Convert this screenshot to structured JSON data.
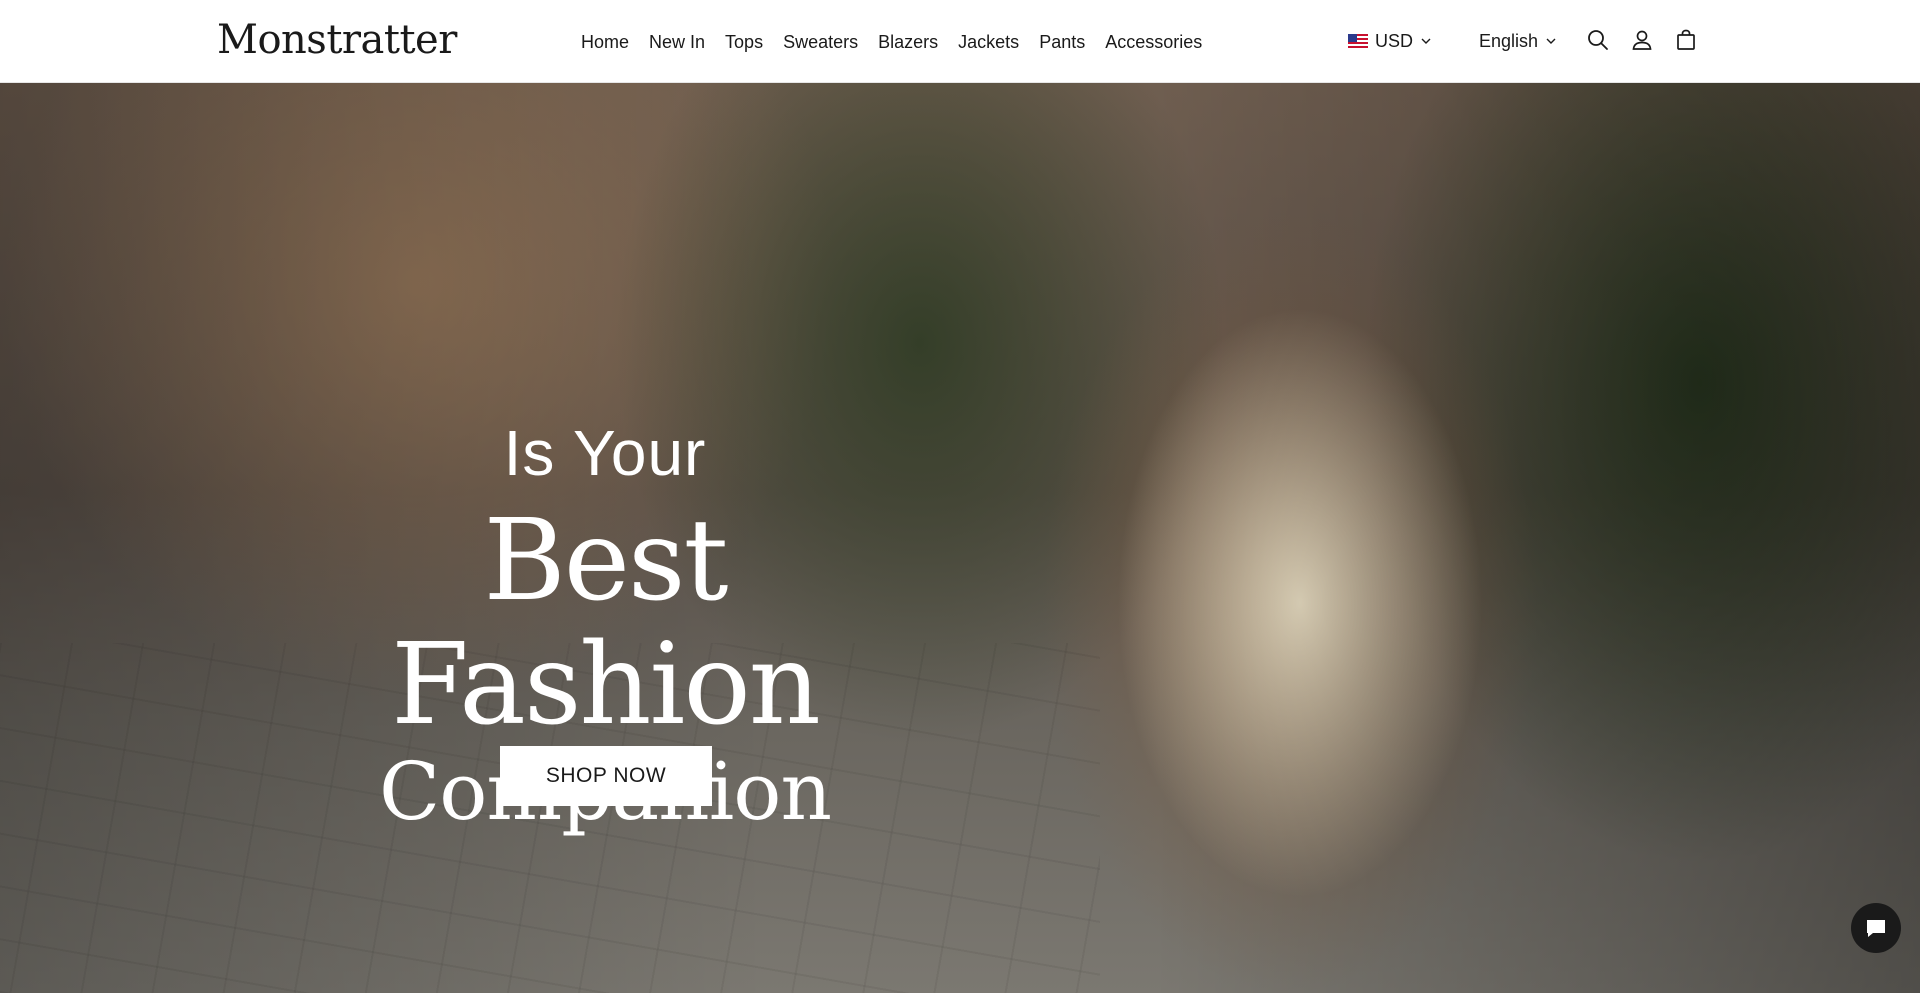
{
  "header": {
    "logo": "Monstratter",
    "nav": [
      {
        "label": "Home"
      },
      {
        "label": "New In"
      },
      {
        "label": "Tops"
      },
      {
        "label": "Sweaters"
      },
      {
        "label": "Blazers"
      },
      {
        "label": "Jackets"
      },
      {
        "label": "Pants"
      },
      {
        "label": "Accessories"
      }
    ],
    "currency": {
      "flag": "us-flag-icon",
      "label": "USD"
    },
    "language": {
      "label": "English"
    },
    "icons": [
      "search-icon",
      "account-icon",
      "bag-icon"
    ]
  },
  "hero": {
    "line1": "Is Your",
    "line2": "Best Fashion",
    "line3": "Companion",
    "cta": "SHOP NOW"
  },
  "chat": {
    "icon": "chat-icon"
  },
  "colors": {
    "text": "#1a1a1a",
    "header_bg": "#ffffff",
    "button_bg": "#ffffff",
    "chat_bg": "#1a1a1a"
  }
}
